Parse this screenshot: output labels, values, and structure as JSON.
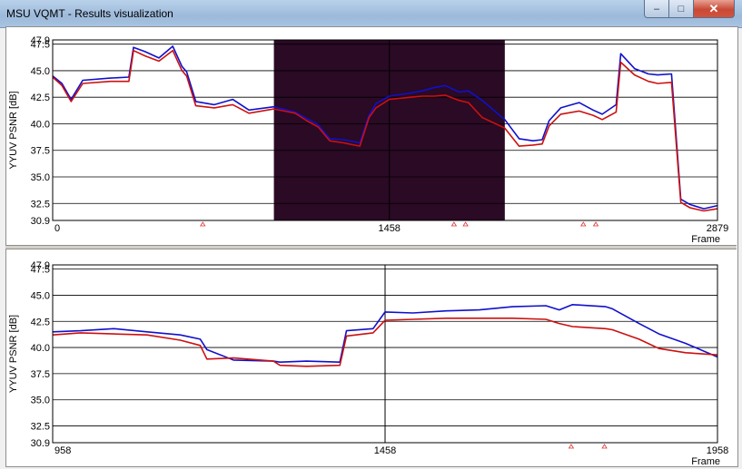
{
  "window": {
    "title": "MSU VQMT - Results visualization",
    "minimize_glyph": "–",
    "maximize_glyph": "□",
    "close_glyph": "✕"
  },
  "colors": {
    "series_a": "#1010cc",
    "series_b": "#cc1010",
    "selection": "#2a0a24",
    "axis_tick_marker": "#dd3333"
  },
  "chart_data": [
    {
      "type": "line",
      "name": "overview",
      "ylabel": "YYUV PSNR [dB]",
      "xlabel": "Frame",
      "xlim": [
        0,
        2879
      ],
      "ylim": [
        30.9,
        47.9
      ],
      "y_ticks": [
        "47.9",
        "47.5",
        "45.0",
        "42.5",
        "40.0",
        "37.5",
        "35.0",
        "32.5",
        "30.9"
      ],
      "x_ticks": [
        {
          "value": 0,
          "label": "0"
        },
        {
          "value": 1458,
          "label": "1458"
        },
        {
          "value": 2879,
          "label": "2879"
        }
      ],
      "selection": [
        958,
        1958
      ],
      "cursor": 1458,
      "markers": [
        650,
        1738,
        1788,
        2298,
        2352
      ],
      "series": [
        {
          "color_key": "series_a",
          "points": [
            [
              0,
              44.5
            ],
            [
              40,
              43.8
            ],
            [
              80,
              42.3
            ],
            [
              130,
              44.1
            ],
            [
              250,
              44.3
            ],
            [
              330,
              44.4
            ],
            [
              350,
              47.2
            ],
            [
              400,
              46.8
            ],
            [
              460,
              46.2
            ],
            [
              520,
              47.3
            ],
            [
              560,
              45.4
            ],
            [
              580,
              44.9
            ],
            [
              620,
              42.1
            ],
            [
              700,
              41.8
            ],
            [
              780,
              42.3
            ],
            [
              850,
              41.3
            ],
            [
              958,
              41.6
            ],
            [
              1050,
              41.1
            ],
            [
              1100,
              40.5
            ],
            [
              1150,
              39.9
            ],
            [
              1200,
              38.6
            ],
            [
              1260,
              38.5
            ],
            [
              1330,
              38.2
            ],
            [
              1370,
              40.8
            ],
            [
              1400,
              41.9
            ],
            [
              1458,
              42.6
            ],
            [
              1550,
              42.9
            ],
            [
              1600,
              43.1
            ],
            [
              1650,
              43.4
            ],
            [
              1700,
              43.6
            ],
            [
              1760,
              43.0
            ],
            [
              1800,
              43.1
            ],
            [
              1860,
              42.2
            ],
            [
              1958,
              40.4
            ],
            [
              2020,
              38.6
            ],
            [
              2080,
              38.4
            ],
            [
              2120,
              38.5
            ],
            [
              2150,
              40.3
            ],
            [
              2200,
              41.5
            ],
            [
              2280,
              42.0
            ],
            [
              2340,
              41.3
            ],
            [
              2380,
              40.9
            ],
            [
              2440,
              41.8
            ],
            [
              2460,
              46.6
            ],
            [
              2520,
              45.2
            ],
            [
              2580,
              44.7
            ],
            [
              2620,
              44.6
            ],
            [
              2680,
              44.7
            ],
            [
              2720,
              32.9
            ],
            [
              2760,
              32.4
            ],
            [
              2820,
              32.0
            ],
            [
              2879,
              32.3
            ]
          ]
        },
        {
          "color_key": "series_b",
          "points": [
            [
              0,
              44.4
            ],
            [
              40,
              43.6
            ],
            [
              80,
              42.1
            ],
            [
              130,
              43.8
            ],
            [
              250,
              44.0
            ],
            [
              330,
              44.0
            ],
            [
              350,
              46.9
            ],
            [
              400,
              46.4
            ],
            [
              460,
              45.9
            ],
            [
              520,
              46.9
            ],
            [
              560,
              45.0
            ],
            [
              580,
              44.5
            ],
            [
              620,
              41.7
            ],
            [
              700,
              41.5
            ],
            [
              780,
              41.8
            ],
            [
              850,
              41.0
            ],
            [
              958,
              41.4
            ],
            [
              1050,
              41.0
            ],
            [
              1100,
              40.3
            ],
            [
              1150,
              39.7
            ],
            [
              1200,
              38.4
            ],
            [
              1260,
              38.2
            ],
            [
              1330,
              37.9
            ],
            [
              1370,
              40.6
            ],
            [
              1400,
              41.5
            ],
            [
              1458,
              42.3
            ],
            [
              1550,
              42.5
            ],
            [
              1600,
              42.6
            ],
            [
              1650,
              42.6
            ],
            [
              1700,
              42.7
            ],
            [
              1760,
              42.2
            ],
            [
              1800,
              42.0
            ],
            [
              1860,
              40.6
            ],
            [
              1958,
              39.6
            ],
            [
              2020,
              37.9
            ],
            [
              2080,
              38.0
            ],
            [
              2120,
              38.1
            ],
            [
              2150,
              39.8
            ],
            [
              2200,
              40.9
            ],
            [
              2280,
              41.2
            ],
            [
              2340,
              40.8
            ],
            [
              2380,
              40.4
            ],
            [
              2440,
              41.1
            ],
            [
              2460,
              45.8
            ],
            [
              2520,
              44.6
            ],
            [
              2580,
              44.0
            ],
            [
              2620,
              43.8
            ],
            [
              2680,
              43.9
            ],
            [
              2720,
              32.6
            ],
            [
              2760,
              32.1
            ],
            [
              2820,
              31.8
            ],
            [
              2879,
              32.0
            ]
          ]
        }
      ]
    },
    {
      "type": "line",
      "name": "zoomed",
      "ylabel": "YYUV PSNR [dB]",
      "xlabel": "Frame",
      "xlim": [
        958,
        1958
      ],
      "ylim": [
        30.9,
        47.9
      ],
      "y_ticks": [
        "47.9",
        "47.5",
        "45.0",
        "42.5",
        "40.0",
        "37.5",
        "35.0",
        "32.5",
        "30.9"
      ],
      "x_ticks": [
        {
          "value": 958,
          "label": "958"
        },
        {
          "value": 1458,
          "label": "1458"
        },
        {
          "value": 1958,
          "label": "1958"
        }
      ],
      "cursor": 1458,
      "markers": [
        1738,
        1788
      ],
      "series": [
        {
          "color_key": "series_a",
          "points": [
            [
              958,
              41.5
            ],
            [
              1000,
              41.6
            ],
            [
              1050,
              41.8
            ],
            [
              1100,
              41.5
            ],
            [
              1150,
              41.2
            ],
            [
              1180,
              40.8
            ],
            [
              1190,
              39.8
            ],
            [
              1230,
              38.8
            ],
            [
              1290,
              38.7
            ],
            [
              1300,
              38.6
            ],
            [
              1340,
              38.7
            ],
            [
              1390,
              38.6
            ],
            [
              1400,
              41.6
            ],
            [
              1440,
              41.8
            ],
            [
              1458,
              43.4
            ],
            [
              1500,
              43.3
            ],
            [
              1550,
              43.5
            ],
            [
              1600,
              43.6
            ],
            [
              1650,
              43.9
            ],
            [
              1700,
              44.0
            ],
            [
              1720,
              43.6
            ],
            [
              1740,
              44.1
            ],
            [
              1790,
              43.9
            ],
            [
              1800,
              43.7
            ],
            [
              1840,
              42.3
            ],
            [
              1870,
              41.3
            ],
            [
              1910,
              40.4
            ],
            [
              1958,
              39.1
            ]
          ]
        },
        {
          "color_key": "series_b",
          "points": [
            [
              958,
              41.2
            ],
            [
              1000,
              41.4
            ],
            [
              1050,
              41.3
            ],
            [
              1100,
              41.2
            ],
            [
              1150,
              40.7
            ],
            [
              1180,
              40.2
            ],
            [
              1190,
              38.9
            ],
            [
              1230,
              39.0
            ],
            [
              1290,
              38.7
            ],
            [
              1300,
              38.3
            ],
            [
              1340,
              38.2
            ],
            [
              1390,
              38.3
            ],
            [
              1400,
              41.1
            ],
            [
              1440,
              41.4
            ],
            [
              1458,
              42.6
            ],
            [
              1500,
              42.7
            ],
            [
              1550,
              42.8
            ],
            [
              1600,
              42.8
            ],
            [
              1650,
              42.8
            ],
            [
              1700,
              42.7
            ],
            [
              1720,
              42.3
            ],
            [
              1740,
              42.0
            ],
            [
              1790,
              41.8
            ],
            [
              1800,
              41.7
            ],
            [
              1840,
              40.8
            ],
            [
              1870,
              39.9
            ],
            [
              1910,
              39.5
            ],
            [
              1958,
              39.3
            ]
          ]
        }
      ]
    }
  ]
}
